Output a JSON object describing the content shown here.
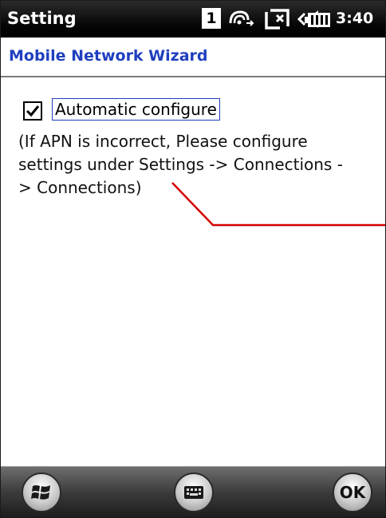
{
  "status_bar": {
    "app_title": "Setting",
    "network_number": "1",
    "time": "3:40"
  },
  "header": {
    "title": "Mobile Network Wizard"
  },
  "content": {
    "auto_configure": {
      "label": "Automatic configure",
      "checked": true
    },
    "note_lines": [
      "(If APN is incorrect, Please configure",
      "settings under Settings -> Connections -",
      "> Connections)"
    ]
  },
  "soft_bar": {
    "ok_label": "OK",
    "icons": [
      "windows-start-icon",
      "keyboard-icon",
      "ok-button"
    ]
  },
  "colors": {
    "title_blue": "#1f3fbf",
    "annotation_red": "#d40000"
  }
}
